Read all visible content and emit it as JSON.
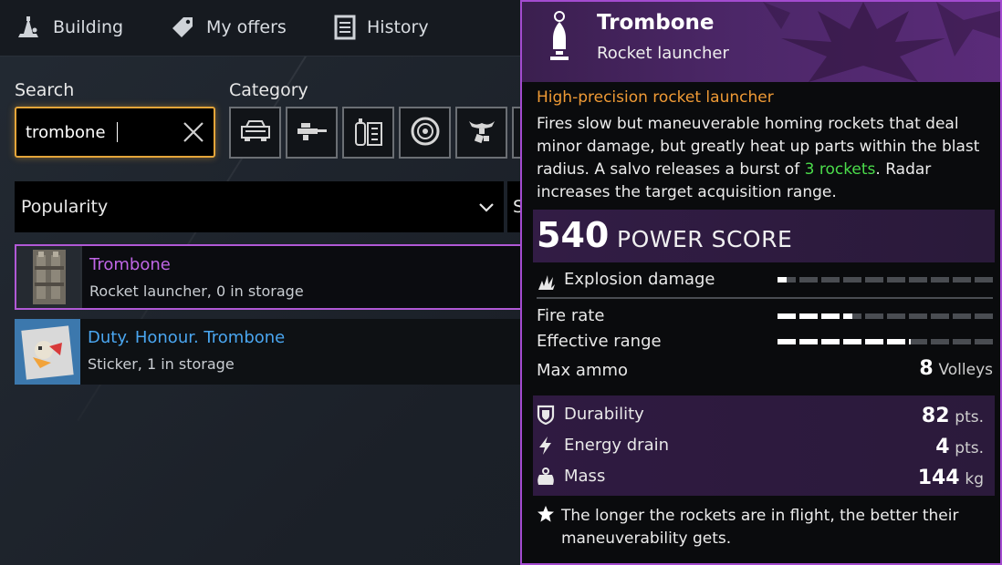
{
  "nav": {
    "items": [
      {
        "label": "Building",
        "icon": "crane-icon"
      },
      {
        "label": "My offers",
        "icon": "tag-icon"
      },
      {
        "label": "History",
        "icon": "document-icon"
      }
    ]
  },
  "search": {
    "label": "Search",
    "value": "trombone"
  },
  "category": {
    "label": "Category",
    "buttons": [
      "cabin-icon",
      "weapon-icon",
      "module-icon",
      "wheel-icon",
      "decor-icon"
    ]
  },
  "sort": {
    "label": "Popularity",
    "second_label": "S"
  },
  "results": [
    {
      "name": "Trombone",
      "sub": "Rocket launcher, 0 in storage",
      "name_color": "#c065e6"
    },
    {
      "name": "Duty. Honour. Trombone",
      "sub": "Sticker, 1 in storage",
      "name_color": "#4aa6f0"
    }
  ],
  "tooltip": {
    "title": "Trombone",
    "subtitle": "Rocket launcher",
    "rarity": "High-precision rocket launcher",
    "desc_before": "Fires slow but maneuverable homing rockets that deal minor damage, but greatly heat up parts within the blast radius. A salvo releases a burst of ",
    "desc_highlight": "3 rockets",
    "desc_after": ". Radar increases the target acquisition range.",
    "power_score": "540",
    "power_label": "POWER SCORE",
    "stats": {
      "explosion_damage": {
        "label": "Explosion damage",
        "level": 0.7
      },
      "fire_rate": {
        "label": "Fire rate",
        "level": 3.5
      },
      "effective_range": {
        "label": "Effective range",
        "level": 6.1
      },
      "max_ammo": {
        "label": "Max ammo",
        "value": "8",
        "unit": "Volleys"
      }
    },
    "attributes": {
      "durability": {
        "label": "Durability",
        "value": "82",
        "unit": "pts."
      },
      "energy_drain": {
        "label": "Energy drain",
        "value": "4",
        "unit": "pts."
      },
      "mass": {
        "label": "Mass",
        "value": "144",
        "unit": "kg"
      }
    },
    "note": "The longer the rockets are in flight, the better their maneuverability gets."
  },
  "colors": {
    "accent_gold": "#e4a53a",
    "accent_purple": "#a34bd0",
    "rarity_orange": "#ef9a35",
    "highlight_green": "#4bdc4b"
  }
}
